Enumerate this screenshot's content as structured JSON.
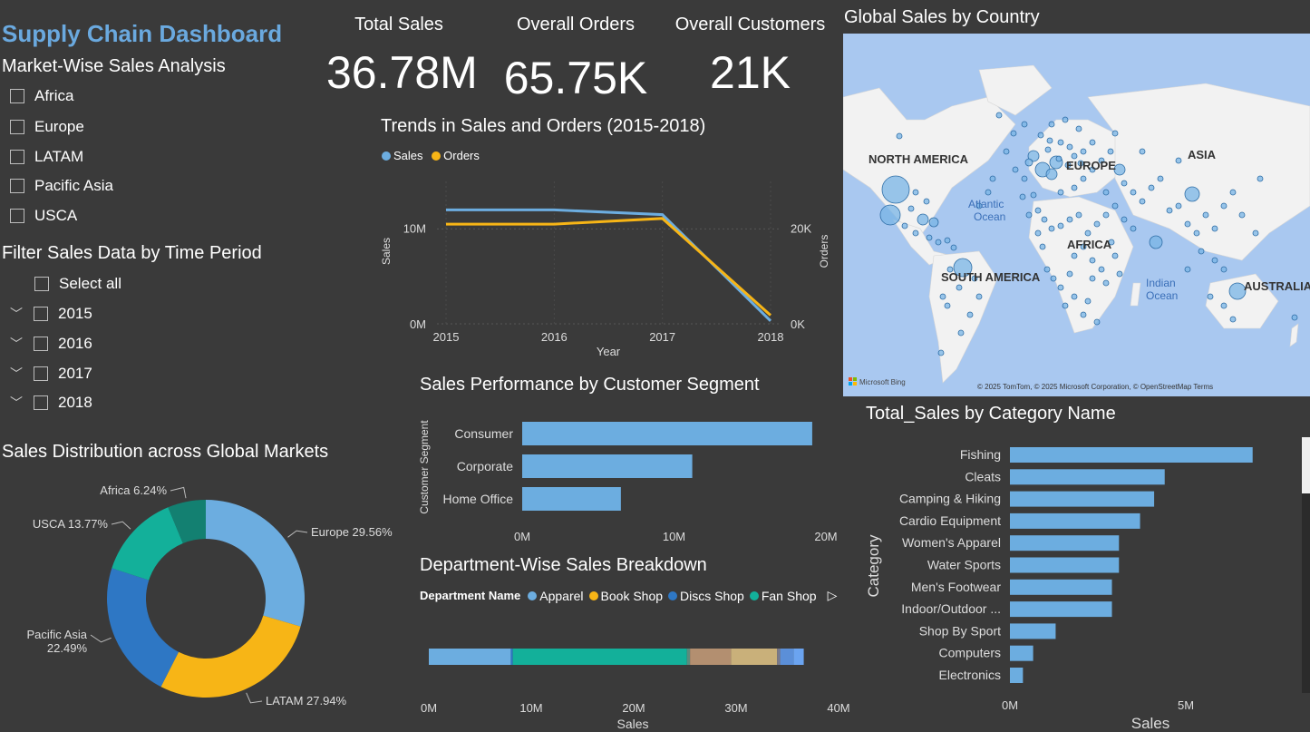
{
  "dashboard_title": "Supply Chain Dashboard",
  "market_filter": {
    "title": "Market-Wise Sales Analysis",
    "items": [
      "Africa",
      "Europe",
      "LATAM",
      "Pacific Asia",
      "USCA"
    ]
  },
  "time_filter": {
    "title": "Filter Sales Data by Time Period",
    "select_all": "Select all",
    "years": [
      "2015",
      "2016",
      "2017",
      "2018"
    ]
  },
  "kpis": [
    {
      "label": "Total Sales",
      "value": "36.78M"
    },
    {
      "label": "Overall Orders",
      "value": "65.75K"
    },
    {
      "label": "Overall Customers",
      "value": "21K"
    }
  ],
  "colors": {
    "blue": "#6cade0",
    "orange": "#f7b516",
    "darkblue": "#2e77c4",
    "teal": "#13b09a",
    "darkteal": "#138071"
  },
  "donut": {
    "title": "Sales Distribution across Global Markets",
    "chart_data": {
      "type": "pie",
      "slices": [
        {
          "name": "Europe",
          "value": 29.56,
          "label": "Europe 29.56%",
          "color": "#6cade0"
        },
        {
          "name": "LATAM",
          "value": 27.94,
          "label": "LATAM 27.94%",
          "color": "#f7b516"
        },
        {
          "name": "Pacific Asia",
          "value": 22.49,
          "label": "Pacific Asia 22.49%",
          "color": "#2e77c4"
        },
        {
          "name": "USCA",
          "value": 13.77,
          "label": "USCA 13.77%",
          "color": "#13b09a"
        },
        {
          "name": "Africa",
          "value": 6.24,
          "label": "Africa 6.24%",
          "color": "#138071"
        }
      ]
    }
  },
  "trend": {
    "title": "Trends in Sales and Orders (2015-2018)",
    "legend": [
      "Sales",
      "Orders"
    ],
    "chart_data": {
      "type": "line",
      "x": [
        2015,
        2016,
        2017,
        2018
      ],
      "xlabel": "Year",
      "ylabel_left": "Sales",
      "ylabel_right": "Orders",
      "left_ticks": [
        "0M",
        "10M"
      ],
      "right_ticks": [
        "0K",
        "20K"
      ],
      "series": [
        {
          "name": "Sales",
          "axis": "left",
          "values": [
            12.0,
            12.0,
            11.5,
            0.3
          ],
          "color": "#6cade0"
        },
        {
          "name": "Orders",
          "axis": "right",
          "values": [
            21000,
            21000,
            22200,
            1800
          ],
          "color": "#f7b516"
        }
      ]
    }
  },
  "segment": {
    "title": "Sales Performance by Customer Segment",
    "chart_data": {
      "type": "bar",
      "orientation": "horizontal",
      "categories": [
        "Consumer",
        "Corporate",
        "Home Office"
      ],
      "values": [
        19.1,
        11.2,
        6.5
      ],
      "ylabel": "Customer Segment",
      "ticks": [
        "0M",
        "10M",
        "20M"
      ],
      "xlim": [
        0,
        20
      ]
    }
  },
  "department": {
    "title": "Department-Wise Sales Breakdown",
    "legend_title": "Department Name",
    "legend": [
      {
        "name": "Apparel",
        "color": "#6cade0"
      },
      {
        "name": "Book Shop",
        "color": "#f7b516"
      },
      {
        "name": "Discs Shop",
        "color": "#2e77c4"
      },
      {
        "name": "Fan Shop",
        "color": "#13b09a"
      }
    ],
    "chart_data": {
      "type": "bar",
      "orientation": "stacked-horizontal",
      "xlabel": "Sales",
      "ticks": [
        "0M",
        "10M",
        "20M",
        "30M",
        "40M"
      ],
      "xlim": [
        0,
        40
      ],
      "segments": [
        {
          "name": "Apparel",
          "value": 8.0,
          "color": "#6cade0"
        },
        {
          "name": "Discs Shop",
          "value": 0.2,
          "color": "#2e77c4"
        },
        {
          "name": "Fan Shop",
          "value": 17.0,
          "color": "#13b09a"
        },
        {
          "name": "",
          "value": 0.3,
          "color": "#5c8a7c"
        },
        {
          "name": "",
          "value": 4.0,
          "color": "#b38f70"
        },
        {
          "name": "",
          "value": 4.5,
          "color": "#c9b07a"
        },
        {
          "name": "",
          "value": 0.3,
          "color": "#7a7a8a"
        },
        {
          "name": "",
          "value": 1.3,
          "color": "#5b8fd8"
        },
        {
          "name": "",
          "value": 1.0,
          "color": "#6ba4f0"
        }
      ]
    }
  },
  "map": {
    "title": "Global Sales by Country",
    "labels": {
      "north_america": "NORTH AMERICA",
      "south_america": "SOUTH AMERICA",
      "europe": "EUROPE",
      "africa": "AFRICA",
      "asia": "ASIA",
      "australia": "AUSTRALIA",
      "atlantic": "Atlantic\nOcean",
      "indian": "Indian\nOcean"
    },
    "bing": "Microsoft Bing",
    "credits": "© 2025 TomTom, © 2025 Microsoft Corporation, © OpenStreetMap  Terms"
  },
  "category": {
    "title": "Total_Sales by Category Name",
    "chart_data": {
      "type": "bar",
      "orientation": "horizontal",
      "ylabel": "Category",
      "xlabel": "Sales",
      "ticks": [
        "0M",
        "5M"
      ],
      "xlim": [
        0,
        6
      ],
      "categories": [
        "Fishing",
        "Cleats",
        "Camping & Hiking",
        "Cardio Equipment",
        "Women's Apparel",
        "Water Sports",
        "Men's Footwear",
        "Indoor/Outdoor ...",
        "Shop By Sport",
        "Computers",
        "Electronics"
      ],
      "values": [
        6.9,
        4.4,
        4.1,
        3.7,
        3.1,
        3.1,
        2.9,
        2.9,
        1.3,
        0.66,
        0.37
      ]
    }
  }
}
